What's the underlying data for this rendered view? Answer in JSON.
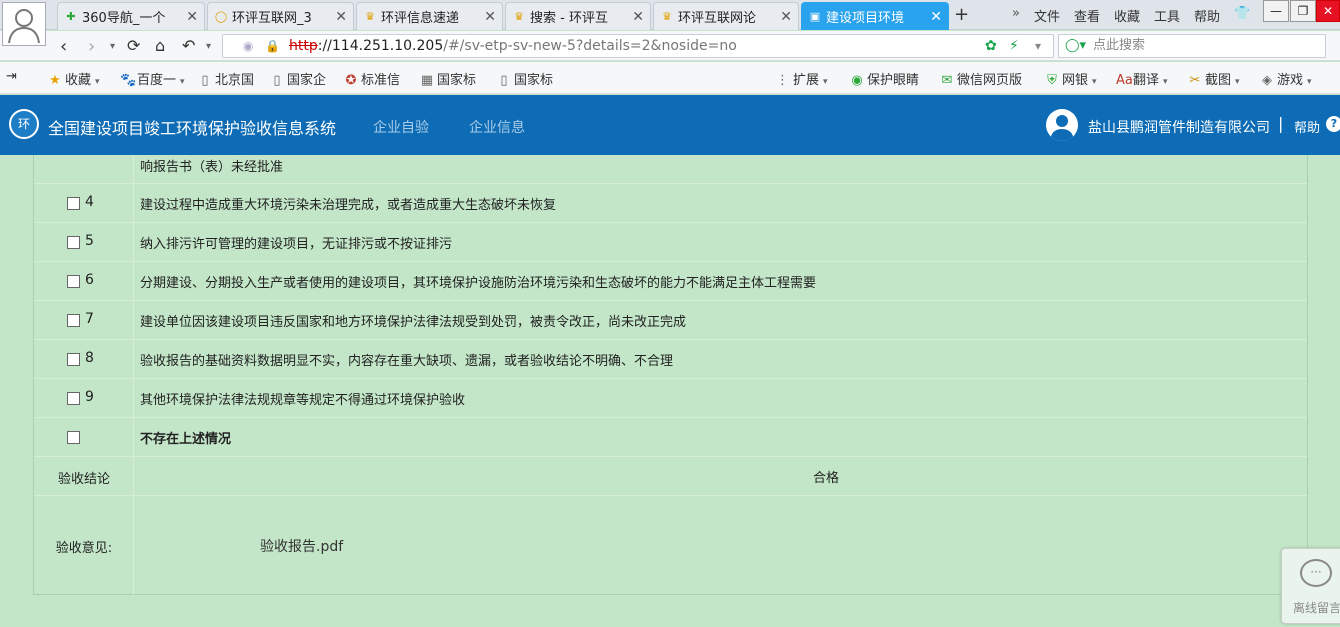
{
  "browser": {
    "tabs": [
      {
        "label": "360导航_一个",
        "icon": "shield-icon",
        "icon_color": "#2fa83a",
        "active": false
      },
      {
        "label": "环评互联网_3",
        "icon": "globe-icon",
        "icon_color": "#e0a000",
        "active": false
      },
      {
        "label": "环评信息速递",
        "icon": "trophy-icon",
        "icon_color": "#e0a000",
        "active": false
      },
      {
        "label": "搜索 - 环评互",
        "icon": "trophy-icon",
        "icon_color": "#e0a000",
        "active": false
      },
      {
        "label": "环评互联网论",
        "icon": "trophy-icon",
        "icon_color": "#e0a000",
        "active": false
      },
      {
        "label": "建设项目环境",
        "icon": "page-icon",
        "icon_color": "#ffffff",
        "active": true
      }
    ],
    "new_tab": "+",
    "menus": [
      "文件",
      "查看",
      "收藏",
      "工具",
      "帮助"
    ],
    "window_controls": {
      "minimize": "—",
      "restore": "❐",
      "close": "✕"
    },
    "url": {
      "protocol": "http",
      "rest_host": "://114.251.10.205",
      "rest_path": "/#/sv-etp-sv-new-5?details=2&noside=no"
    },
    "search_placeholder": "点此搜索",
    "bookmarks": [
      {
        "label": "收藏",
        "icon": "star-icon"
      },
      {
        "label": "百度一",
        "icon": "paw-icon"
      },
      {
        "label": "北京国",
        "icon": "page-icon"
      },
      {
        "label": "国家企",
        "icon": "page-icon"
      },
      {
        "label": "标准信",
        "icon": "emblem-icon"
      },
      {
        "label": "国家标",
        "icon": "grid-icon"
      },
      {
        "label": "国家标",
        "icon": "page-icon"
      },
      {
        "label": "扩展",
        "icon": "apps-icon"
      },
      {
        "label": "保护眼睛",
        "icon": "eye-icon"
      },
      {
        "label": "微信网页版",
        "icon": "wechat-icon"
      },
      {
        "label": "网银",
        "icon": "bank-shield-icon"
      },
      {
        "label": "翻译",
        "icon": "translate-icon"
      },
      {
        "label": "截图",
        "icon": "scissors-icon"
      },
      {
        "label": "游戏",
        "icon": "gamepad-icon"
      }
    ]
  },
  "app": {
    "system_title": "全国建设项目竣工环境保护验收信息系统",
    "nav": [
      "企业自验",
      "企业信息"
    ],
    "company": "盐山县鹏润管件制造有限公司",
    "separator": "|",
    "help": "帮助",
    "help_mark": "?",
    "logo_text": "环"
  },
  "table": {
    "partial_row_text": "响报告书（表）未经批准",
    "items": [
      {
        "num": "4",
        "text": "建设过程中造成重大环境污染未治理完成，或者造成重大生态破坏未恢复"
      },
      {
        "num": "5",
        "text": "纳入排污许可管理的建设项目，无证排污或不按证排污"
      },
      {
        "num": "6",
        "text": "分期建设、分期投入生产或者使用的建设项目，其环境保护设施防治环境污染和生态破坏的能力不能满足主体工程需要"
      },
      {
        "num": "7",
        "text": "建设单位因该建设项目违反国家和地方环境保护法律法规受到处罚，被责令改正，尚未改正完成"
      },
      {
        "num": "8",
        "text": "验收报告的基础资料数据明显不实，内容存在重大缺项、遗漏，或者验收结论不明确、不合理"
      },
      {
        "num": "9",
        "text": "其他环境保护法律法规规章等规定不得通过环境保护验收"
      }
    ],
    "none_option": "不存在上述情况",
    "conclusion_label": "验收结论",
    "conclusion_value": "合格",
    "opinion_label": "验收意见:",
    "opinion_file": "验收报告.pdf"
  },
  "chat_widget": {
    "label": "离线留言",
    "icon": "chat-icon"
  }
}
